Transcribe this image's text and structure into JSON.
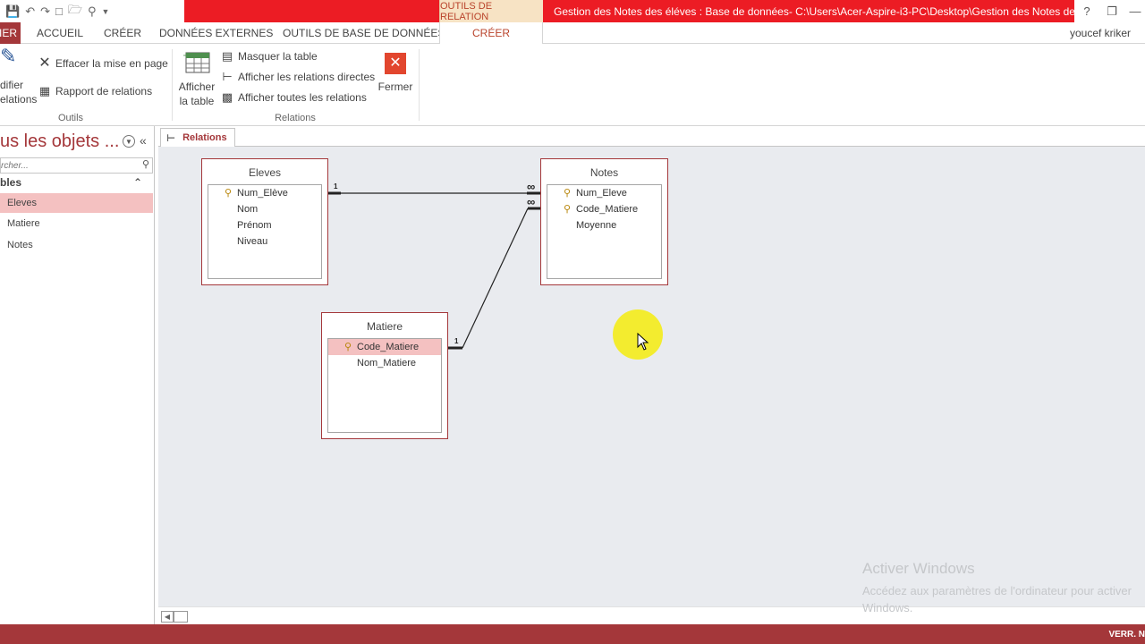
{
  "window": {
    "contextual_tab_group": "OUTILS DE RELATION",
    "title": "Gestion des Notes des éléves : Base de données- C:\\Users\\Acer-Aspire-i3-PC\\Desktop\\Gestion des Notes de...",
    "help": "?",
    "restore": "❐",
    "collapse_ribbon": "⌃"
  },
  "tabs": {
    "file": "IER",
    "accueil": "ACCUEIL",
    "creer": "CRÉER",
    "donnees_externes": "DONNÉES EXTERNES",
    "outils_bdd": "OUTILS DE BASE DE DONNÉES",
    "creer_active": "CRÉER",
    "user": "youcef kriker"
  },
  "ribbon": {
    "modifier_line1": "difier",
    "modifier_line2": "elations",
    "effacer": "Effacer la mise en page",
    "rapport": "Rapport de relations",
    "group_outils": "Outils",
    "afficher_line1": "Afficher",
    "afficher_line2": "la table",
    "masquer": "Masquer la table",
    "afficher_directes": "Afficher les relations directes",
    "afficher_toutes": "Afficher toutes les relations",
    "fermer": "Fermer",
    "group_relations": "Relations"
  },
  "nav": {
    "title": "us les objets ...",
    "search_placeholder": "rcher...",
    "group": "bles",
    "items": [
      "Eleves",
      "Matiere",
      "Notes"
    ]
  },
  "document": {
    "tab_label": "Relations"
  },
  "tables": {
    "eleves": {
      "title": "Eleves",
      "fields": [
        "Num_Elève",
        "Nom",
        "Prénom",
        "Niveau"
      ]
    },
    "notes": {
      "title": "Notes",
      "fields": [
        "Num_Eleve",
        "Code_Matiere",
        "Moyenne"
      ]
    },
    "matiere": {
      "title": "Matiere",
      "fields": [
        "Code_Matiere",
        "Nom_Matiere"
      ]
    }
  },
  "relationships": {
    "one_label": "1",
    "many_label": "∞"
  },
  "watermark": {
    "title": "Activer Windows",
    "subtitle": "Accédez aux paramètres de l'ordinateur pour activer Windows."
  },
  "status": {
    "right": "VERR. N"
  }
}
